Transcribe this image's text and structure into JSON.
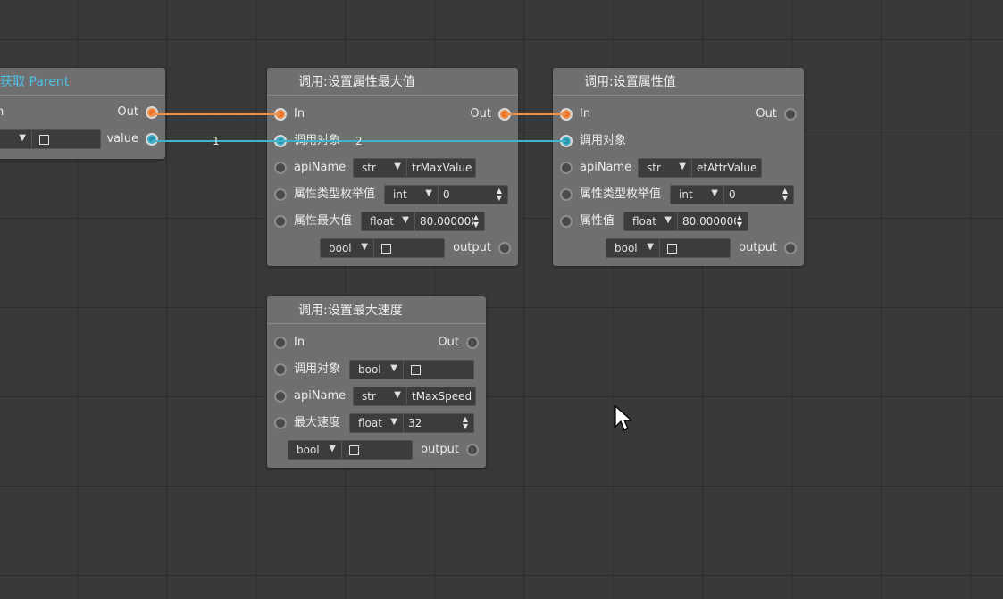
{
  "nodes": {
    "get_parent": {
      "title": "获取 Parent",
      "in_label": "n",
      "out_label": "Out",
      "value_label": "value",
      "type": "ol"
    },
    "set_attr_max": {
      "title": "调用:设置属性最大值",
      "in_label": "In",
      "out_label": "Out",
      "target_label": "调用对象",
      "apiname_label": "apiName",
      "apiname_type": "str",
      "apiname_value": "trMaxValue",
      "enum_label": "属性类型枚举值",
      "enum_type": "int",
      "enum_value": "0",
      "max_label": "属性最大值",
      "max_type": "float",
      "max_value": "80.000000",
      "output_type": "bool",
      "output_label": "output"
    },
    "set_attr_value": {
      "title": "调用:设置属性值",
      "in_label": "In",
      "out_label": "Out",
      "target_label": "调用对象",
      "apiname_label": "apiName",
      "apiname_type": "str",
      "apiname_value": "etAttrValue",
      "enum_label": "属性类型枚举值",
      "enum_type": "int",
      "enum_value": "0",
      "value_label": "属性值",
      "value_type": "float",
      "value_value": "80.000000",
      "output_type": "bool",
      "output_label": "output"
    },
    "set_max_speed": {
      "title": "调用:设置最大速度",
      "in_label": "In",
      "out_label": "Out",
      "target_label": "调用对象",
      "target_type": "bool",
      "apiname_label": "apiName",
      "apiname_type": "str",
      "apiname_value": "tMaxSpeed",
      "speed_label": "最大速度",
      "speed_type": "float",
      "speed_value": "32",
      "output_type": "bool",
      "output_label": "output"
    }
  },
  "wires": {
    "label_1": "1",
    "label_2": "2",
    "exec_color": "#f0914b",
    "data_color": "#3fb3cc"
  },
  "colors": {
    "background": "#393939",
    "node_body": "#6f6f6f",
    "title_accent": "#4ec2e6"
  }
}
